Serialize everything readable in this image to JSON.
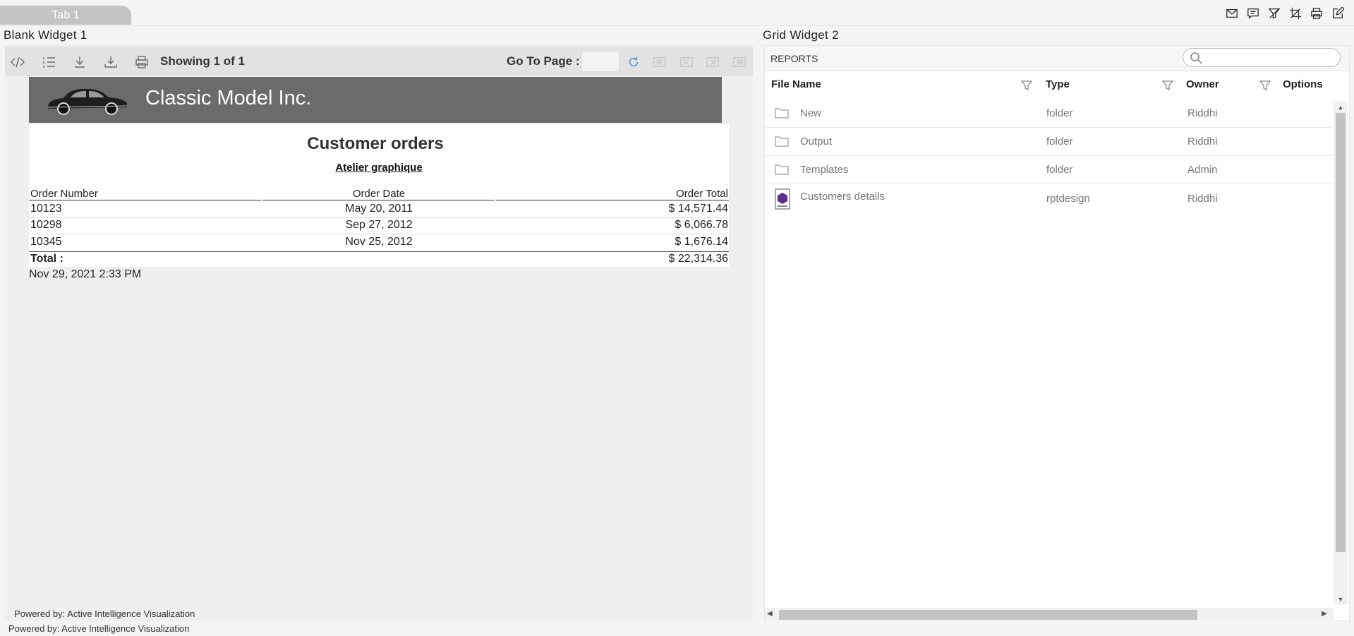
{
  "tab": {
    "label": "Tab 1"
  },
  "widget1": {
    "title": "Blank Widget 1",
    "toolbar": {
      "showing": "Showing 1 of 1",
      "goto_label": "Go To Page :",
      "goto_value": ""
    },
    "report": {
      "company": "Classic Model Inc.",
      "title": "Customer orders",
      "subtitle": "Atelier graphique",
      "columns": [
        "Order Number",
        "Order Date",
        "Order Total"
      ],
      "rows": [
        [
          "10123",
          "May 20, 2011",
          "$ 14,571.44"
        ],
        [
          "10298",
          "Sep 27, 2012",
          "$ 6,066.78"
        ],
        [
          "10345",
          "Nov 25, 2012",
          "$ 1,676.14"
        ]
      ],
      "total_label": "Total :",
      "total_value": "$ 22,314.36",
      "timestamp": "Nov 29, 2021 2:33 PM"
    },
    "footer": "Powered by: Active Intelligence Visualization"
  },
  "widget2": {
    "title": "Grid Widget 2",
    "header": "REPORTS",
    "search_placeholder": "",
    "columns": [
      "File Name",
      "Type",
      "Owner",
      "Options"
    ],
    "rows": [
      [
        "New",
        "folder",
        "Riddhi"
      ],
      [
        "Output",
        "folder",
        "Riddhi"
      ],
      [
        "Templates",
        "folder",
        "Admin"
      ],
      [
        "Customers details",
        "rptdesign",
        "Riddhi"
      ]
    ]
  },
  "page_footer": "Powered by: Active Intelligence Visualization",
  "colors": {
    "banner": "#6b6b6b",
    "tab": "#c4c4c4",
    "refresh": "#4a90d9"
  },
  "icons": [
    "mail-icon",
    "comment-icon",
    "clear-filter-icon",
    "crop-icon",
    "print-icon",
    "edit-icon",
    "code-icon",
    "list-icon",
    "download-icon",
    "export-icon",
    "printer-icon",
    "refresh-icon",
    "first-page-icon",
    "prev-page-icon",
    "next-page-icon",
    "last-page-icon",
    "search-icon",
    "filter-icon",
    "folder-icon",
    "rptdesign-file-icon",
    "car-logo"
  ]
}
